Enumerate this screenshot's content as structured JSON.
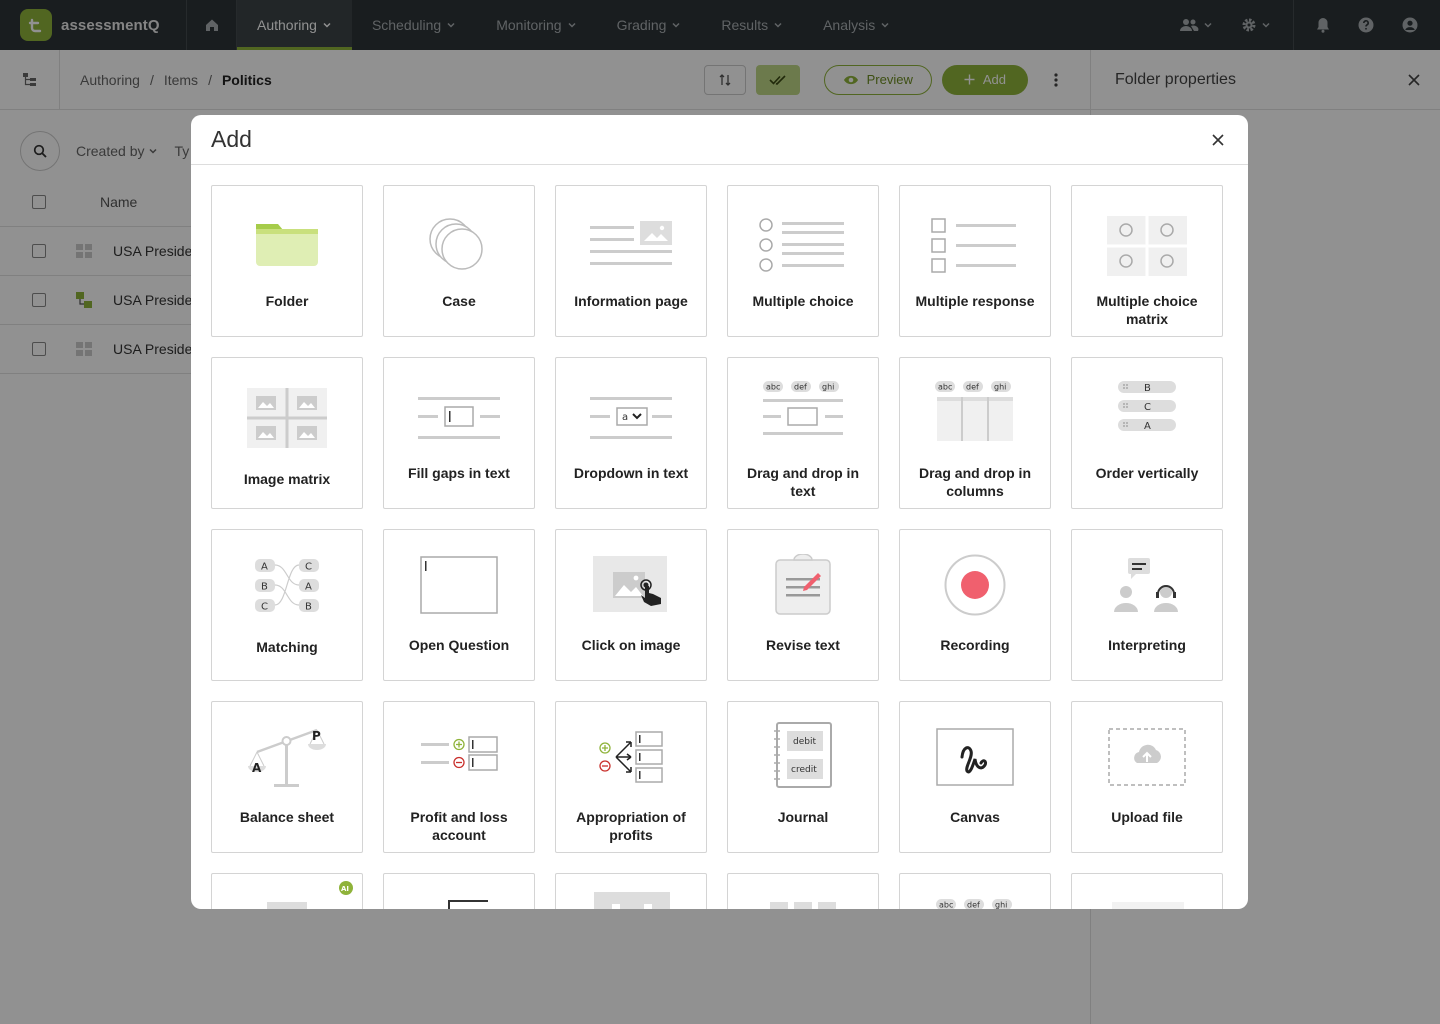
{
  "app": {
    "name": "assessmentQ"
  },
  "nav": {
    "items": [
      {
        "label": "Authoring"
      },
      {
        "label": "Scheduling"
      },
      {
        "label": "Monitoring"
      },
      {
        "label": "Grading"
      },
      {
        "label": "Results"
      },
      {
        "label": "Analysis"
      }
    ],
    "active": "Authoring",
    "icons": [
      "home-icon",
      "users-icon",
      "gear-icon",
      "bell-icon",
      "help-icon",
      "account-icon"
    ]
  },
  "breadcrumb": [
    "Authoring",
    "Items",
    "Politics"
  ],
  "toolbar": {
    "preview_label": "Preview",
    "add_label": "Add"
  },
  "side_panel": {
    "title": "Folder properties"
  },
  "filters": {
    "created_by": "Created by",
    "type_partial": "Ty"
  },
  "table": {
    "header_name": "Name",
    "rows": [
      {
        "name": "USA President"
      },
      {
        "name": "USA President"
      },
      {
        "name": "USA President"
      }
    ]
  },
  "modal": {
    "title": "Add",
    "items": [
      {
        "label": "Folder",
        "icon": "folder-icon"
      },
      {
        "label": "Case",
        "icon": "case-icon"
      },
      {
        "label": "Information page",
        "icon": "information-page-icon"
      },
      {
        "label": "Multiple choice",
        "icon": "multiple-choice-icon"
      },
      {
        "label": "Multiple response",
        "icon": "multiple-response-icon"
      },
      {
        "label": "Multiple choice matrix",
        "icon": "multiple-choice-matrix-icon"
      },
      {
        "label": "Image matrix",
        "icon": "image-matrix-icon"
      },
      {
        "label": "Fill gaps in text",
        "icon": "fill-gaps-icon"
      },
      {
        "label": "Dropdown in text",
        "icon": "dropdown-in-text-icon"
      },
      {
        "label": "Drag and drop in text",
        "icon": "drag-drop-text-icon"
      },
      {
        "label": "Drag and drop in columns",
        "icon": "drag-drop-columns-icon"
      },
      {
        "label": "Order vertically",
        "icon": "order-vertically-icon"
      },
      {
        "label": "Matching",
        "icon": "matching-icon"
      },
      {
        "label": "Open Question",
        "icon": "open-question-icon"
      },
      {
        "label": "Click on image",
        "icon": "click-on-image-icon"
      },
      {
        "label": "Revise text",
        "icon": "revise-text-icon"
      },
      {
        "label": "Recording",
        "icon": "recording-icon"
      },
      {
        "label": "Interpreting",
        "icon": "interpreting-icon"
      },
      {
        "label": "Balance sheet",
        "icon": "balance-sheet-icon"
      },
      {
        "label": "Profit and loss account",
        "icon": "profit-loss-icon"
      },
      {
        "label": "Appropriation of profits",
        "icon": "appropriation-icon"
      },
      {
        "label": "Journal",
        "icon": "journal-icon"
      },
      {
        "label": "Canvas",
        "icon": "canvas-icon"
      },
      {
        "label": "Upload file",
        "icon": "upload-file-icon"
      }
    ],
    "illustration_text": {
      "tags": [
        "abc",
        "def",
        "ghi"
      ],
      "order": [
        "B",
        "C",
        "A"
      ],
      "matching_left": [
        "A",
        "B",
        "C"
      ],
      "matching_right": [
        "C",
        "A",
        "B"
      ],
      "dropdown_value": "a",
      "balance_left": "A",
      "balance_right": "P",
      "journal_debit": "debit",
      "journal_credit": "credit",
      "ai_badge": "AI"
    }
  },
  "colors": {
    "nav_bg": "#2d3437",
    "accent": "#8fb33a",
    "recording": "#f0606e"
  }
}
